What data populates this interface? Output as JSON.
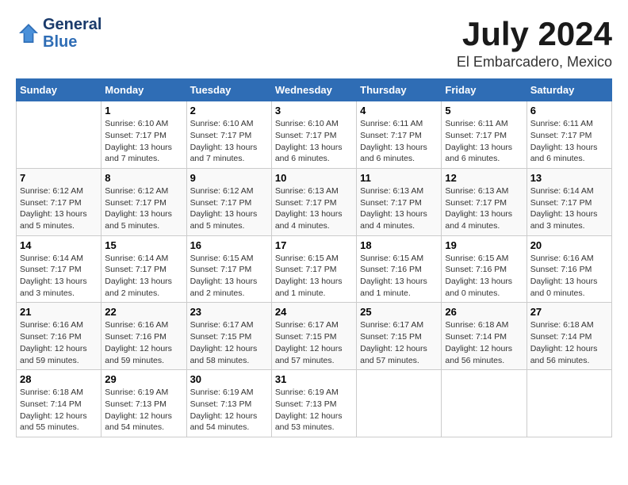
{
  "header": {
    "logo_line1": "General",
    "logo_line2": "Blue",
    "month": "July 2024",
    "location": "El Embarcadero, Mexico"
  },
  "weekdays": [
    "Sunday",
    "Monday",
    "Tuesday",
    "Wednesday",
    "Thursday",
    "Friday",
    "Saturday"
  ],
  "weeks": [
    [
      {
        "day": "",
        "sunrise": "",
        "sunset": "",
        "daylight": ""
      },
      {
        "day": "1",
        "sunrise": "Sunrise: 6:10 AM",
        "sunset": "Sunset: 7:17 PM",
        "daylight": "Daylight: 13 hours and 7 minutes."
      },
      {
        "day": "2",
        "sunrise": "Sunrise: 6:10 AM",
        "sunset": "Sunset: 7:17 PM",
        "daylight": "Daylight: 13 hours and 7 minutes."
      },
      {
        "day": "3",
        "sunrise": "Sunrise: 6:10 AM",
        "sunset": "Sunset: 7:17 PM",
        "daylight": "Daylight: 13 hours and 6 minutes."
      },
      {
        "day": "4",
        "sunrise": "Sunrise: 6:11 AM",
        "sunset": "Sunset: 7:17 PM",
        "daylight": "Daylight: 13 hours and 6 minutes."
      },
      {
        "day": "5",
        "sunrise": "Sunrise: 6:11 AM",
        "sunset": "Sunset: 7:17 PM",
        "daylight": "Daylight: 13 hours and 6 minutes."
      },
      {
        "day": "6",
        "sunrise": "Sunrise: 6:11 AM",
        "sunset": "Sunset: 7:17 PM",
        "daylight": "Daylight: 13 hours and 6 minutes."
      }
    ],
    [
      {
        "day": "7",
        "sunrise": "Sunrise: 6:12 AM",
        "sunset": "Sunset: 7:17 PM",
        "daylight": "Daylight: 13 hours and 5 minutes."
      },
      {
        "day": "8",
        "sunrise": "Sunrise: 6:12 AM",
        "sunset": "Sunset: 7:17 PM",
        "daylight": "Daylight: 13 hours and 5 minutes."
      },
      {
        "day": "9",
        "sunrise": "Sunrise: 6:12 AM",
        "sunset": "Sunset: 7:17 PM",
        "daylight": "Daylight: 13 hours and 5 minutes."
      },
      {
        "day": "10",
        "sunrise": "Sunrise: 6:13 AM",
        "sunset": "Sunset: 7:17 PM",
        "daylight": "Daylight: 13 hours and 4 minutes."
      },
      {
        "day": "11",
        "sunrise": "Sunrise: 6:13 AM",
        "sunset": "Sunset: 7:17 PM",
        "daylight": "Daylight: 13 hours and 4 minutes."
      },
      {
        "day": "12",
        "sunrise": "Sunrise: 6:13 AM",
        "sunset": "Sunset: 7:17 PM",
        "daylight": "Daylight: 13 hours and 4 minutes."
      },
      {
        "day": "13",
        "sunrise": "Sunrise: 6:14 AM",
        "sunset": "Sunset: 7:17 PM",
        "daylight": "Daylight: 13 hours and 3 minutes."
      }
    ],
    [
      {
        "day": "14",
        "sunrise": "Sunrise: 6:14 AM",
        "sunset": "Sunset: 7:17 PM",
        "daylight": "Daylight: 13 hours and 3 minutes."
      },
      {
        "day": "15",
        "sunrise": "Sunrise: 6:14 AM",
        "sunset": "Sunset: 7:17 PM",
        "daylight": "Daylight: 13 hours and 2 minutes."
      },
      {
        "day": "16",
        "sunrise": "Sunrise: 6:15 AM",
        "sunset": "Sunset: 7:17 PM",
        "daylight": "Daylight: 13 hours and 2 minutes."
      },
      {
        "day": "17",
        "sunrise": "Sunrise: 6:15 AM",
        "sunset": "Sunset: 7:17 PM",
        "daylight": "Daylight: 13 hours and 1 minute."
      },
      {
        "day": "18",
        "sunrise": "Sunrise: 6:15 AM",
        "sunset": "Sunset: 7:16 PM",
        "daylight": "Daylight: 13 hours and 1 minute."
      },
      {
        "day": "19",
        "sunrise": "Sunrise: 6:15 AM",
        "sunset": "Sunset: 7:16 PM",
        "daylight": "Daylight: 13 hours and 0 minutes."
      },
      {
        "day": "20",
        "sunrise": "Sunrise: 6:16 AM",
        "sunset": "Sunset: 7:16 PM",
        "daylight": "Daylight: 13 hours and 0 minutes."
      }
    ],
    [
      {
        "day": "21",
        "sunrise": "Sunrise: 6:16 AM",
        "sunset": "Sunset: 7:16 PM",
        "daylight": "Daylight: 12 hours and 59 minutes."
      },
      {
        "day": "22",
        "sunrise": "Sunrise: 6:16 AM",
        "sunset": "Sunset: 7:16 PM",
        "daylight": "Daylight: 12 hours and 59 minutes."
      },
      {
        "day": "23",
        "sunrise": "Sunrise: 6:17 AM",
        "sunset": "Sunset: 7:15 PM",
        "daylight": "Daylight: 12 hours and 58 minutes."
      },
      {
        "day": "24",
        "sunrise": "Sunrise: 6:17 AM",
        "sunset": "Sunset: 7:15 PM",
        "daylight": "Daylight: 12 hours and 57 minutes."
      },
      {
        "day": "25",
        "sunrise": "Sunrise: 6:17 AM",
        "sunset": "Sunset: 7:15 PM",
        "daylight": "Daylight: 12 hours and 57 minutes."
      },
      {
        "day": "26",
        "sunrise": "Sunrise: 6:18 AM",
        "sunset": "Sunset: 7:14 PM",
        "daylight": "Daylight: 12 hours and 56 minutes."
      },
      {
        "day": "27",
        "sunrise": "Sunrise: 6:18 AM",
        "sunset": "Sunset: 7:14 PM",
        "daylight": "Daylight: 12 hours and 56 minutes."
      }
    ],
    [
      {
        "day": "28",
        "sunrise": "Sunrise: 6:18 AM",
        "sunset": "Sunset: 7:14 PM",
        "daylight": "Daylight: 12 hours and 55 minutes."
      },
      {
        "day": "29",
        "sunrise": "Sunrise: 6:19 AM",
        "sunset": "Sunset: 7:13 PM",
        "daylight": "Daylight: 12 hours and 54 minutes."
      },
      {
        "day": "30",
        "sunrise": "Sunrise: 6:19 AM",
        "sunset": "Sunset: 7:13 PM",
        "daylight": "Daylight: 12 hours and 54 minutes."
      },
      {
        "day": "31",
        "sunrise": "Sunrise: 6:19 AM",
        "sunset": "Sunset: 7:13 PM",
        "daylight": "Daylight: 12 hours and 53 minutes."
      },
      {
        "day": "",
        "sunrise": "",
        "sunset": "",
        "daylight": ""
      },
      {
        "day": "",
        "sunrise": "",
        "sunset": "",
        "daylight": ""
      },
      {
        "day": "",
        "sunrise": "",
        "sunset": "",
        "daylight": ""
      }
    ]
  ]
}
